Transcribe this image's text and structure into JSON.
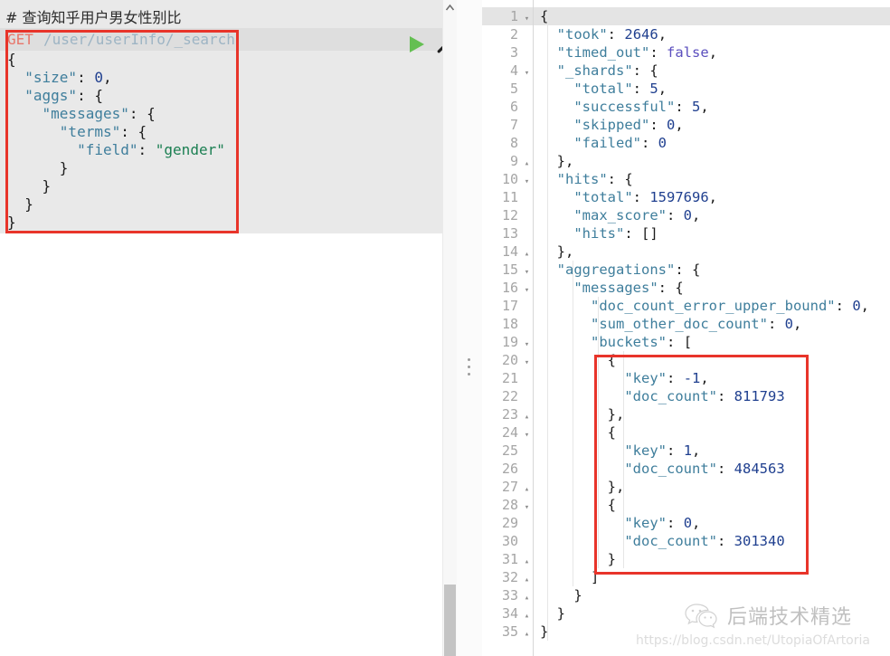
{
  "request_editor": {
    "comment": "# 查询知乎用户男女性别比",
    "method": "GET",
    "path": "/user/userInfo/_search",
    "body_lines": [
      "{",
      "  \"size\": 0,",
      "  \"aggs\": {",
      "    \"messages\": {",
      "      \"terms\": {",
      "        \"field\": \"gender\"",
      "      }",
      "    }",
      "  }",
      "}"
    ],
    "run_icon": "play-icon",
    "run_label": "Click to send request",
    "wrench_icon": "wrench-icon",
    "wrench_label": "Open documentation / auto indent",
    "annotation_color": "#e8342a"
  },
  "scrollbar": {
    "up_icon": "chevron-up-icon"
  },
  "splitter": {
    "handle_icon": "drag-handle-icon"
  },
  "response_viewer": {
    "active_line": 1,
    "lines": [
      {
        "n": 1,
        "fold": "down",
        "text": "{"
      },
      {
        "n": 2,
        "fold": "",
        "text": "  \"took\": 2646,"
      },
      {
        "n": 3,
        "fold": "",
        "text": "  \"timed_out\": false,"
      },
      {
        "n": 4,
        "fold": "down",
        "text": "  \"_shards\": {"
      },
      {
        "n": 5,
        "fold": "",
        "text": "    \"total\": 5,"
      },
      {
        "n": 6,
        "fold": "",
        "text": "    \"successful\": 5,"
      },
      {
        "n": 7,
        "fold": "",
        "text": "    \"skipped\": 0,"
      },
      {
        "n": 8,
        "fold": "",
        "text": "    \"failed\": 0"
      },
      {
        "n": 9,
        "fold": "up",
        "text": "  },"
      },
      {
        "n": 10,
        "fold": "down",
        "text": "  \"hits\": {"
      },
      {
        "n": 11,
        "fold": "",
        "text": "    \"total\": 1597696,"
      },
      {
        "n": 12,
        "fold": "",
        "text": "    \"max_score\": 0,"
      },
      {
        "n": 13,
        "fold": "",
        "text": "    \"hits\": []"
      },
      {
        "n": 14,
        "fold": "up",
        "text": "  },"
      },
      {
        "n": 15,
        "fold": "down",
        "text": "  \"aggregations\": {"
      },
      {
        "n": 16,
        "fold": "down",
        "text": "    \"messages\": {"
      },
      {
        "n": 17,
        "fold": "",
        "text": "      \"doc_count_error_upper_bound\": 0,"
      },
      {
        "n": 18,
        "fold": "",
        "text": "      \"sum_other_doc_count\": 0,"
      },
      {
        "n": 19,
        "fold": "down",
        "text": "      \"buckets\": ["
      },
      {
        "n": 20,
        "fold": "down",
        "text": "        {"
      },
      {
        "n": 21,
        "fold": "",
        "text": "          \"key\": -1,"
      },
      {
        "n": 22,
        "fold": "",
        "text": "          \"doc_count\": 811793"
      },
      {
        "n": 23,
        "fold": "up",
        "text": "        },"
      },
      {
        "n": 24,
        "fold": "down",
        "text": "        {"
      },
      {
        "n": 25,
        "fold": "",
        "text": "          \"key\": 1,"
      },
      {
        "n": 26,
        "fold": "",
        "text": "          \"doc_count\": 484563"
      },
      {
        "n": 27,
        "fold": "up",
        "text": "        },"
      },
      {
        "n": 28,
        "fold": "down",
        "text": "        {"
      },
      {
        "n": 29,
        "fold": "",
        "text": "          \"key\": 0,"
      },
      {
        "n": 30,
        "fold": "",
        "text": "          \"doc_count\": 301340"
      },
      {
        "n": 31,
        "fold": "up",
        "text": "        }"
      },
      {
        "n": 32,
        "fold": "up",
        "text": "      ]"
      },
      {
        "n": 33,
        "fold": "up",
        "text": "    }"
      },
      {
        "n": 34,
        "fold": "up",
        "text": "  }"
      },
      {
        "n": 35,
        "fold": "up",
        "text": "}"
      }
    ],
    "annotation_color": "#e8342a"
  },
  "response_values": {
    "took": 2646,
    "timed_out": false,
    "shards_total": 5,
    "shards_successful": 5,
    "shards_skipped": 0,
    "shards_failed": 0,
    "hits_total": 1597696,
    "max_score": 0,
    "doc_count_error_upper_bound": 0,
    "sum_other_doc_count": 0,
    "buckets": [
      {
        "key": -1,
        "doc_count": 811793
      },
      {
        "key": 1,
        "doc_count": 484563
      },
      {
        "key": 0,
        "doc_count": 301340
      }
    ]
  },
  "watermarks": {
    "wechat_icon": "wechat-logo-icon",
    "wechat_text": "后端技术精选",
    "url": "https://blog.csdn.net/UtopiaOfArtoria"
  }
}
